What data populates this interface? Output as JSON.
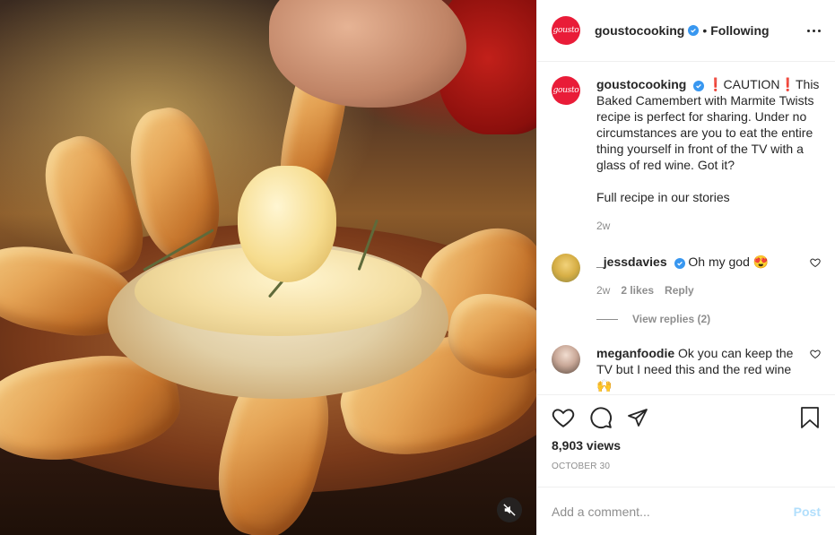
{
  "post": {
    "author": "goustocooking",
    "logo_text": "gousto",
    "follow_status": "Following",
    "separator": "•",
    "views": "8,903 views",
    "date": "OCTOBER 30"
  },
  "caption": {
    "author": "goustocooking",
    "text_before_first_mark": "",
    "mark": "❗",
    "line1": "CAUTION",
    "line2": "This Baked Camembert with Marmite Twists recipe is perfect for sharing. Under no circumstances are you to eat the entire thing yourself in front of the TV with a glass of red wine. Got it?",
    "line3": "Full recipe in our stories",
    "age": "2w"
  },
  "comments": [
    {
      "author": "_jessdavies",
      "text": "Oh my god 😍",
      "age": "2w",
      "likes": "2 likes",
      "reply_label": "Reply",
      "view_replies": "View replies (2)"
    },
    {
      "author": "meganfoodie",
      "text": "Ok you can keep the TV but I need this and the red wine 🙌"
    }
  ],
  "composer": {
    "placeholder": "Add a comment...",
    "post_label": "Post"
  },
  "colors": {
    "brand_red": "#e91c38",
    "verified_blue": "#3897f0",
    "post_disabled": "#b2dffc"
  },
  "icons": [
    "mute-icon",
    "more-options-icon",
    "verified-icon",
    "heart-icon",
    "comment-icon",
    "share-icon",
    "bookmark-icon"
  ]
}
